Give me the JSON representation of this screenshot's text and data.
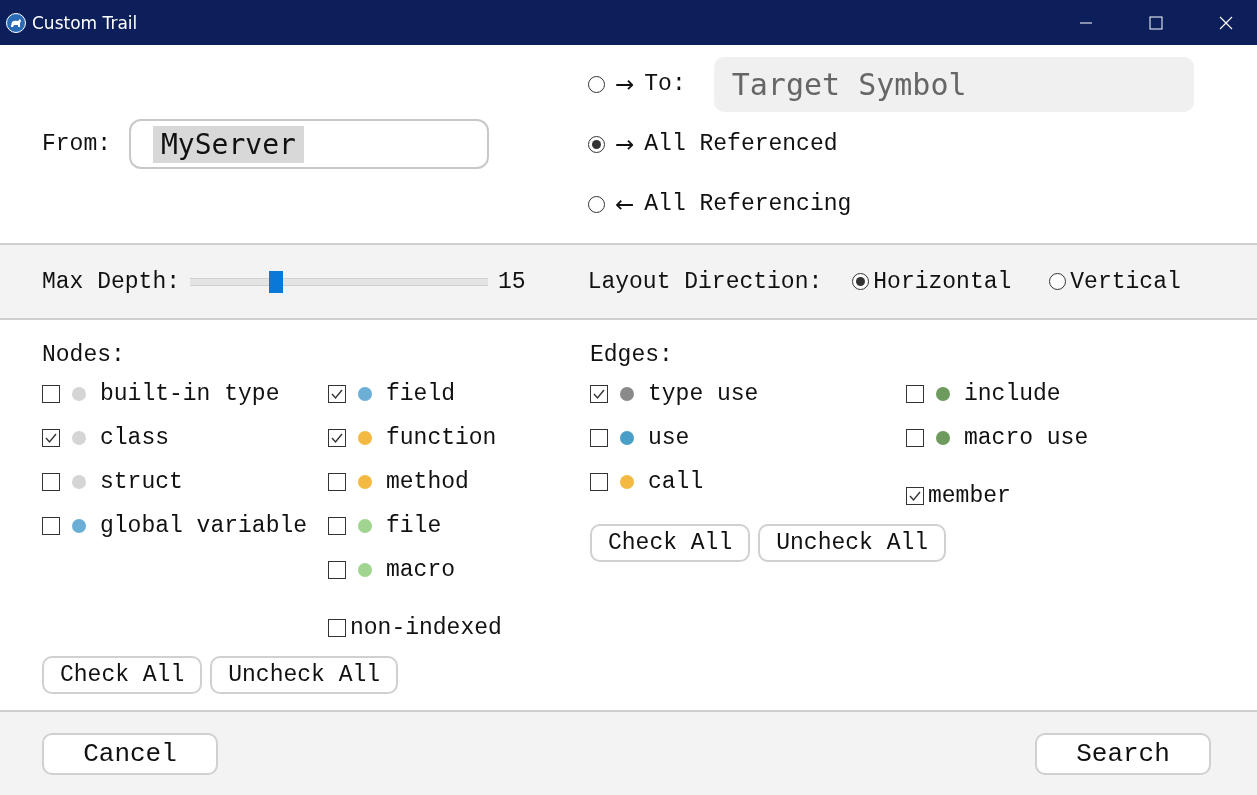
{
  "window": {
    "title": "Custom Trail"
  },
  "from": {
    "label": "From:",
    "value": "MyServer"
  },
  "directions": [
    {
      "arrow": "→",
      "label": "To:",
      "selected": false,
      "field_placeholder": "Target Symbol"
    },
    {
      "arrow": "→",
      "label": "All Referenced",
      "selected": true
    },
    {
      "arrow": "←",
      "label": "All Referencing",
      "selected": false
    }
  ],
  "max_depth": {
    "label": "Max Depth:",
    "level": 0.29,
    "value": "15"
  },
  "layout_direction": {
    "label": "Layout Direction:",
    "options": [
      {
        "label": "Horizontal",
        "selected": true
      },
      {
        "label": "Vertical",
        "selected": false
      }
    ]
  },
  "nodes": {
    "title": "Nodes:",
    "columns": [
      [
        {
          "kind": "dot",
          "label": "built-in type",
          "checked": false,
          "color": "#d5d5d5"
        },
        {
          "kind": "dot",
          "label": "class",
          "checked": true,
          "color": "#d5d5d5"
        },
        {
          "kind": "dot",
          "label": "struct",
          "checked": false,
          "color": "#d5d5d5"
        },
        {
          "kind": "dot",
          "label": "global variable",
          "checked": false,
          "color": "#6baed6"
        }
      ],
      [
        {
          "kind": "dot",
          "label": "field",
          "checked": true,
          "color": "#6baed6"
        },
        {
          "kind": "dot",
          "label": "function",
          "checked": true,
          "color": "#f4b942"
        },
        {
          "kind": "dot",
          "label": "method",
          "checked": false,
          "color": "#f4b942"
        },
        {
          "kind": "dot",
          "label": "file",
          "checked": false,
          "color": "#a1d490"
        },
        {
          "kind": "dot",
          "label": "macro",
          "checked": false,
          "color": "#a1d490"
        },
        {
          "kind": "plain",
          "label": "non-indexed",
          "checked": false
        }
      ]
    ],
    "buttons": [
      "Check All",
      "Uncheck All"
    ]
  },
  "edges": {
    "title": "Edges:",
    "columns": [
      [
        {
          "kind": "dot",
          "label": "type use",
          "checked": true,
          "color": "#8a8a8a"
        },
        {
          "kind": "dot",
          "label": "use",
          "checked": false,
          "color": "#4a9fc8"
        },
        {
          "kind": "dot",
          "label": "call",
          "checked": false,
          "color": "#f4b942"
        }
      ],
      [
        {
          "kind": "dot",
          "label": "include",
          "checked": false,
          "color": "#6e9a5e"
        },
        {
          "kind": "dot",
          "label": "macro use",
          "checked": false,
          "color": "#6e9a5e"
        },
        {
          "kind": "plain",
          "label": "member",
          "checked": true
        }
      ]
    ],
    "buttons": [
      "Check All",
      "Uncheck All"
    ]
  },
  "footer": {
    "cancel": "Cancel",
    "search": "Search"
  }
}
